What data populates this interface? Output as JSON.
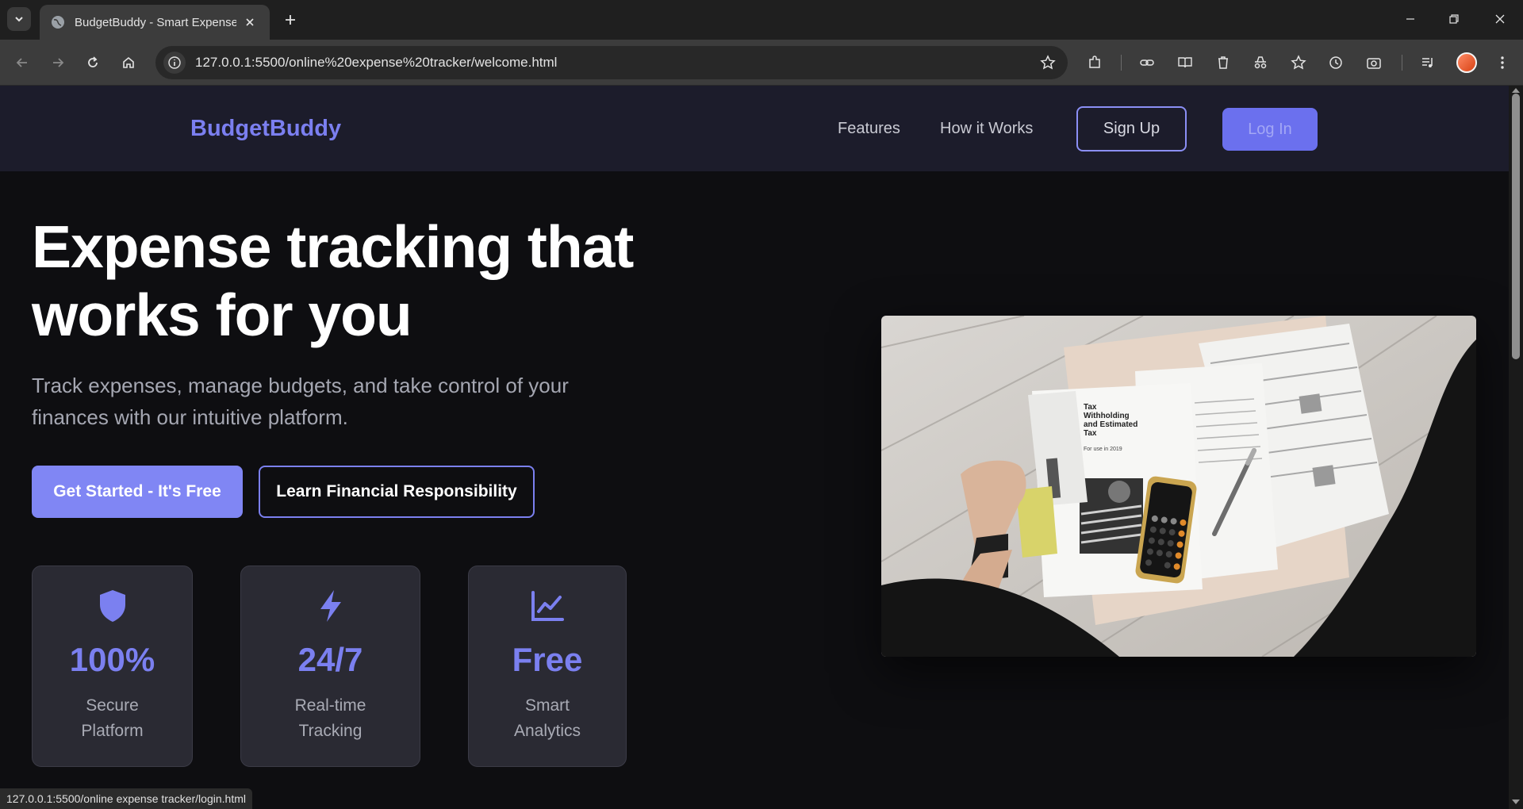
{
  "browser": {
    "tab_title": "BudgetBuddy - Smart Expense T",
    "url": "127.0.0.1:5500/online%20expense%20tracker/welcome.html",
    "status_url": "127.0.0.1:5500/online expense tracker/login.html"
  },
  "nav": {
    "brand": "BudgetBuddy",
    "links": [
      "Features",
      "How it Works"
    ],
    "signup": "Sign Up",
    "login": "Log In"
  },
  "hero": {
    "title_line1": "Expense tracking that",
    "title_line2": "works for you",
    "subtitle": "Track expenses, manage budgets, and take control of your finances with our intuitive platform.",
    "cta_primary": "Get Started - It's Free",
    "cta_secondary": "Learn Financial Responsibility"
  },
  "stats": [
    {
      "icon": "shield-icon",
      "value": "100%",
      "label": "Secure Platform"
    },
    {
      "icon": "lightning-icon",
      "value": "24/7",
      "label": "Real-time Tracking"
    },
    {
      "icon": "chart-line-icon",
      "value": "Free",
      "label": "Smart Analytics"
    }
  ],
  "image_text": {
    "form_title_line1": "Tax",
    "form_title_line2": "Withholding",
    "form_title_line3": "and Estimated",
    "form_title_line4": "Tax",
    "form_year": "For use in 2019"
  },
  "colors": {
    "accent": "#7b80f0",
    "nav_bg": "#1c1c2b",
    "page_bg": "#0e0e11",
    "card_bg": "#2a2a33"
  }
}
